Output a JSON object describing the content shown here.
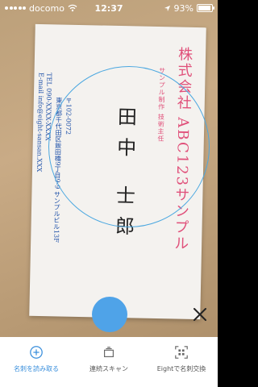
{
  "status_bar": {
    "carrier": "docomo",
    "time": "12:37",
    "battery": "93%",
    "battery_level": 0.93
  },
  "card": {
    "company": "株式会社 ABC123サンプル",
    "department": "サンプル制作 技術主任",
    "name": "田中 士郎",
    "postal_address": "〒102-0072",
    "street_address": "東京都千代田区飯田橋9丁目9-9 サンプルビル13F",
    "tel": "TEL 090-XXXX-XXXX",
    "email": "E-mail info@eight-sansan.XXX"
  },
  "controls": {
    "shutter": "shutter-button",
    "close": "close-button"
  },
  "tabs": [
    {
      "label": "名刺を読み取る",
      "icon": "plus-circle-icon",
      "active": true
    },
    {
      "label": "連続スキャン",
      "icon": "stacked-cards-icon",
      "active": false
    },
    {
      "label": "Eightで名刺交換",
      "icon": "qr-scan-icon",
      "active": false
    }
  ],
  "colors": {
    "accent": "#3a8fdc",
    "company_text": "#e0507a",
    "address_text": "#1c4fa8"
  }
}
